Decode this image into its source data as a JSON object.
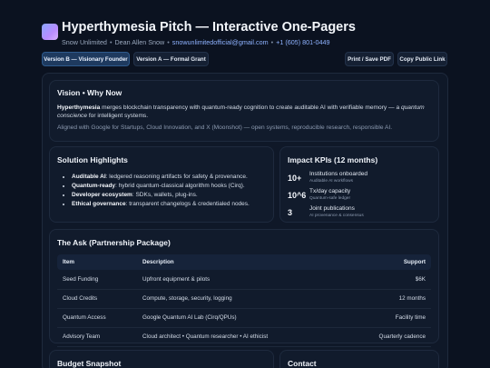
{
  "header": {
    "title": "Hyperthymesia Pitch — Interactive One-Pagers",
    "org": "Snow Unlimited",
    "person": "Dean Allen Snow",
    "email": "snowunlimitedofficial@gmail.com",
    "phone": "+1 (605) 801-0449",
    "separator": "•"
  },
  "toolbar": {
    "tab_b": "Version B — Visionary Founder",
    "tab_a": "Version A — Formal Grant",
    "print": "Print / Save PDF",
    "copy": "Copy Public Link"
  },
  "vision": {
    "heading": "Vision • Why Now",
    "p1_bold": "Hyperthymesia",
    "p1_a": " merges blockchain transparency with quantum-ready cognition to create auditable AI with verifiable memory — a ",
    "p1_em": "quantum conscience",
    "p1_b": " for intelligent systems.",
    "p2": "Aligned with Google for Startups, Cloud Innovation, and X (Moonshot) — open systems, reproducible research, responsible AI."
  },
  "solution": {
    "heading": "Solution Highlights",
    "items": [
      {
        "bold": "Auditable AI",
        "text": ": ledgered reasoning artifacts for safety & provenance."
      },
      {
        "bold": "Quantum-ready",
        "text": ": hybrid quantum-classical algorithm hooks (Cirq)."
      },
      {
        "bold": "Developer ecosystem",
        "text": ": SDKs, wallets, plug-ins."
      },
      {
        "bold": "Ethical governance",
        "text": ": transparent changelogs & credentialed nodes."
      }
    ]
  },
  "kpi": {
    "heading": "Impact KPIs (12 months)",
    "items": [
      {
        "value": "10+",
        "label": "Institutions onboarded",
        "sub": "Auditable AI workflows"
      },
      {
        "value": "10^6",
        "label": "Tx/day capacity",
        "sub": "Quantum-safe ledger"
      },
      {
        "value": "3",
        "label": "Joint publications",
        "sub": "AI provenance & consensus"
      }
    ]
  },
  "ask": {
    "heading": "The Ask (Partnership Package)",
    "columns": [
      "Item",
      "Description",
      "Support"
    ],
    "rows": [
      [
        "Seed Funding",
        "Upfront equipment & pilots",
        "$6K"
      ],
      [
        "Cloud Credits",
        "Compute, storage, security, logging",
        "12 months"
      ],
      [
        "Quantum Access",
        "Google Quantum AI Lab (Cirq/QPUs)",
        "Facility time"
      ],
      [
        "Advisory Team",
        "Cloud architect • Quantum researcher • AI ethicist",
        "Quarterly cadence"
      ]
    ]
  },
  "budget": {
    "heading": "Budget Snapshot"
  },
  "contact": {
    "heading": "Contact"
  }
}
